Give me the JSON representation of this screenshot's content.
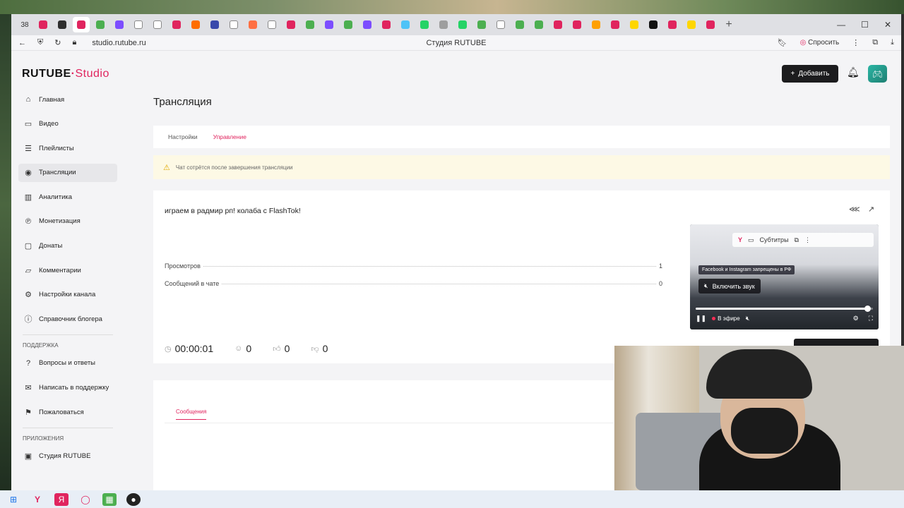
{
  "browser": {
    "tab_count": "38",
    "url": "studio.rutube.ru",
    "page_title": "Студия RUTUBE",
    "ask_label": "Спросить",
    "tab_colors": [
      "#e0245e",
      "#2e2e2e",
      "#e0245e",
      "#4caf50",
      "#7c4dff",
      "#ffffff",
      "#ffffff",
      "#e0245e",
      "#ff6d00",
      "#3949ab",
      "#ffffff",
      "#ff7043",
      "#ffffff",
      "#e0245e",
      "#4caf50",
      "#7c4dff",
      "#4caf50",
      "#7c4dff",
      "#e0245e",
      "#4fc3f7",
      "#25d366",
      "#9e9e9e",
      "#25d366",
      "#4caf50",
      "#ffffff",
      "#4caf50",
      "#4caf50",
      "#e0245e",
      "#e0245e",
      "#ffa000",
      "#e0245e",
      "#ffd600",
      "#111111",
      "#e0245e",
      "#ffd600",
      "#e0245e"
    ]
  },
  "header": {
    "logo_rutube": "RUTUBE",
    "logo_studio": "Studio",
    "add_button": "Добавить"
  },
  "sidebar": {
    "items": [
      {
        "label": "Главная",
        "icon": "home-icon",
        "glyph": "⌂"
      },
      {
        "label": "Видео",
        "icon": "video-icon",
        "glyph": "▭"
      },
      {
        "label": "Плейлисты",
        "icon": "playlist-icon",
        "glyph": "☰"
      },
      {
        "label": "Трансляции",
        "icon": "broadcast-icon",
        "glyph": "◉"
      },
      {
        "label": "Аналитика",
        "icon": "analytics-icon",
        "glyph": "▥"
      },
      {
        "label": "Монетизация",
        "icon": "monetization-icon",
        "glyph": "℗"
      },
      {
        "label": "Донаты",
        "icon": "donate-icon",
        "glyph": "▢"
      },
      {
        "label": "Комментарии",
        "icon": "comment-icon",
        "glyph": "▱"
      },
      {
        "label": "Настройки канала",
        "icon": "gear-icon",
        "glyph": "⚙"
      },
      {
        "label": "Справочник блогера",
        "icon": "info-icon",
        "glyph": "ⓘ"
      }
    ],
    "support_heading": "ПОДДЕРЖКА",
    "support_items": [
      {
        "label": "Вопросы и ответы",
        "icon": "question-icon",
        "glyph": "?"
      },
      {
        "label": "Написать в поддержку",
        "icon": "mail-icon",
        "glyph": "✉"
      },
      {
        "label": "Пожаловаться",
        "icon": "flag-icon",
        "glyph": "⚑"
      }
    ],
    "apps_heading": "ПРИЛОЖЕНИЯ",
    "apps_items": [
      {
        "label": "Студия RUTUBE",
        "icon": "app-icon",
        "glyph": "▣"
      }
    ]
  },
  "main": {
    "title": "Трансляция",
    "tabs": [
      "Настройки",
      "Управление"
    ],
    "warning": "Чат сотрётся после завершения трансляции",
    "stream_title": "играем в радмир рп! колаба с FlashTok!",
    "stats": [
      {
        "label": "Просмотров",
        "value": "1"
      },
      {
        "label": "Сообщений в чате",
        "value": "0"
      }
    ],
    "metrics": {
      "duration": "00:00:01",
      "viewers": "0",
      "likes": "0",
      "dislikes": "0"
    },
    "chat_tab": "Сообщения"
  },
  "player": {
    "subtitles_label": "Субтитры",
    "notice": "Facebook и Instagram запрещены в РФ",
    "unmute_label": "Включить звук",
    "live_label": "В эфире",
    "progress": 0.97
  }
}
